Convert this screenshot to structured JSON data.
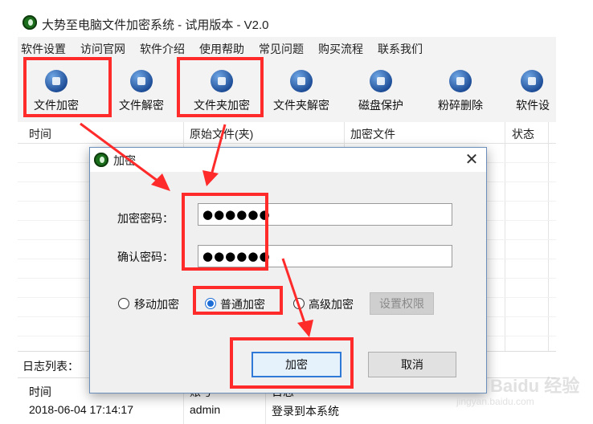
{
  "window": {
    "title": "大势至电脑文件加密系统 - 试用版本 - V2.0"
  },
  "menu": [
    "软件设置",
    "访问官网",
    "软件介绍",
    "使用帮助",
    "常见问题",
    "购买流程",
    "联系我们"
  ],
  "toolbar": [
    {
      "label": "文件加密",
      "icon": "file-lock-icon"
    },
    {
      "label": "文件解密",
      "icon": "file-unlock-icon"
    },
    {
      "label": "文件夹加密",
      "icon": "folder-lock-icon"
    },
    {
      "label": "文件夹解密",
      "icon": "folder-unlock-icon"
    },
    {
      "label": "磁盘保护",
      "icon": "disk-shield-icon"
    },
    {
      "label": "粉碎删除",
      "icon": "shredder-icon"
    },
    {
      "label": "软件设",
      "icon": "gear-icon"
    }
  ],
  "file_table": {
    "columns": [
      "时间",
      "原始文件(夹)",
      "加密文件",
      "状态"
    ]
  },
  "log": {
    "title": "日志列表：",
    "columns": [
      "时间",
      "账号",
      "日志"
    ],
    "rows": [
      {
        "time": "2018-06-04 17:14:17",
        "account": "admin",
        "message": "登录到本系统"
      }
    ]
  },
  "dialog": {
    "title": "加密",
    "password_label": "加密密码：",
    "password_value": "●●●●●●",
    "confirm_label": "确认密码：",
    "confirm_value": "●●●●●●",
    "radios": [
      {
        "label": "移动加密",
        "checked": false
      },
      {
        "label": "普通加密",
        "checked": true
      },
      {
        "label": "高级加密",
        "checked": false
      }
    ],
    "permissions_button": "设置权限",
    "ok_button": "加密",
    "cancel_button": "取消"
  },
  "watermark": {
    "text": "Baidu 经验",
    "sub": "jingyan.baidu.com"
  },
  "colors": {
    "annotation": "#ff2a2a",
    "accent": "#1c6ed6"
  }
}
